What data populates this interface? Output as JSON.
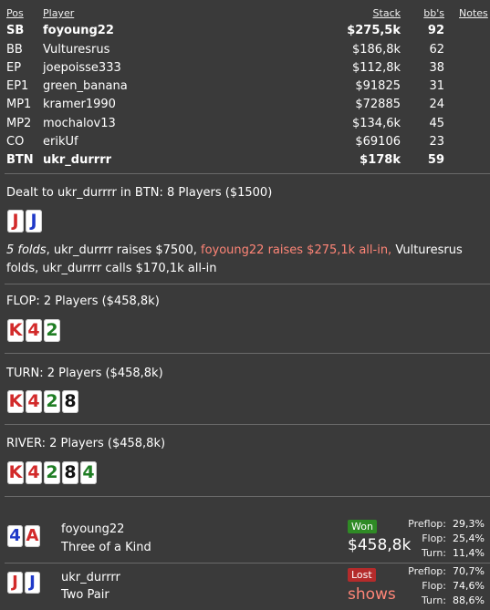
{
  "table": {
    "headers": {
      "pos": "Pos",
      "player": "Player",
      "stack": "Stack",
      "bbs": "bb's",
      "notes": "Notes"
    },
    "rows": [
      {
        "pos": "SB",
        "player": "foyoung22",
        "stack": "$275,5k",
        "bbs": "92",
        "bold": true
      },
      {
        "pos": "BB",
        "player": "Vulturesrus",
        "stack": "$186,8k",
        "bbs": "62",
        "bold": false
      },
      {
        "pos": "EP",
        "player": "joepoisse333",
        "stack": "$112,8k",
        "bbs": "38",
        "bold": false
      },
      {
        "pos": "EP1",
        "player": "green_banana",
        "stack": "$91825",
        "bbs": "31",
        "bold": false
      },
      {
        "pos": "MP1",
        "player": "kramer1990",
        "stack": "$72885",
        "bbs": "24",
        "bold": false
      },
      {
        "pos": "MP2",
        "player": "mochalov13",
        "stack": "$134,6k",
        "bbs": "45",
        "bold": false
      },
      {
        "pos": "CO",
        "player": "erikUf",
        "stack": "$69106",
        "bbs": "23",
        "bold": false
      },
      {
        "pos": "BTN",
        "player": "ukr_durrrr",
        "stack": "$178k",
        "bbs": "59",
        "bold": true
      }
    ]
  },
  "preflop": {
    "title": "Dealt to ukr_durrrr in BTN: 8 Players ($1500)",
    "hero_cards": [
      {
        "rank": "J",
        "color": "#d22a2a"
      },
      {
        "rank": "J",
        "color": "#1f39c8"
      }
    ],
    "action_folds": "5 folds",
    "action_1": ", ukr_durrrr raises $7500, ",
    "action_2": "foyoung22 raises $275,1k all-in,",
    "action_3": " Vulturesrus folds, ukr_durrrr calls $170,1k all-in"
  },
  "flop": {
    "title": "FLOP: 2 Players ($458,8k)",
    "cards": [
      {
        "rank": "K",
        "color": "#d22a2a"
      },
      {
        "rank": "4",
        "color": "#d22a2a"
      },
      {
        "rank": "2",
        "color": "#1f7d24"
      }
    ]
  },
  "turn": {
    "title": "TURN: 2 Players ($458,8k)",
    "cards": [
      {
        "rank": "K",
        "color": "#d22a2a"
      },
      {
        "rank": "4",
        "color": "#d22a2a"
      },
      {
        "rank": "2",
        "color": "#1f7d24"
      },
      {
        "rank": "8",
        "color": "#111111"
      }
    ]
  },
  "river": {
    "title": "RIVER: 2 Players ($458,8k)",
    "cards": [
      {
        "rank": "K",
        "color": "#d22a2a"
      },
      {
        "rank": "4",
        "color": "#d22a2a"
      },
      {
        "rank": "2",
        "color": "#1f7d24"
      },
      {
        "rank": "8",
        "color": "#111111"
      },
      {
        "rank": "4",
        "color": "#1f7d24"
      }
    ]
  },
  "results": [
    {
      "name": "foyoung22",
      "hand": "Three of a Kind",
      "cards": [
        {
          "rank": "4",
          "color": "#1f39c8"
        },
        {
          "rank": "A",
          "color": "#d22a2a"
        }
      ],
      "badge": "Won",
      "status": "won",
      "amount": "$458,8k",
      "equity": [
        {
          "label": "Preflop:",
          "value": "29,3%"
        },
        {
          "label": "Flop:",
          "value": "25,4%"
        },
        {
          "label": "Turn:",
          "value": "11,4%"
        }
      ]
    },
    {
      "name": "ukr_durrrr",
      "hand": "Two Pair",
      "cards": [
        {
          "rank": "J",
          "color": "#d22a2a"
        },
        {
          "rank": "J",
          "color": "#1f39c8"
        }
      ],
      "badge": "Lost",
      "status": "lost",
      "amount": "shows",
      "equity": [
        {
          "label": "Preflop:",
          "value": "70,7%"
        },
        {
          "label": "Flop:",
          "value": "74,6%"
        },
        {
          "label": "Turn:",
          "value": "88,6%"
        }
      ]
    }
  ],
  "colors": {
    "background": "#3a3a3a",
    "highlight": "#ff8577",
    "won": "#2f8a25",
    "lost": "#b42b2b"
  }
}
